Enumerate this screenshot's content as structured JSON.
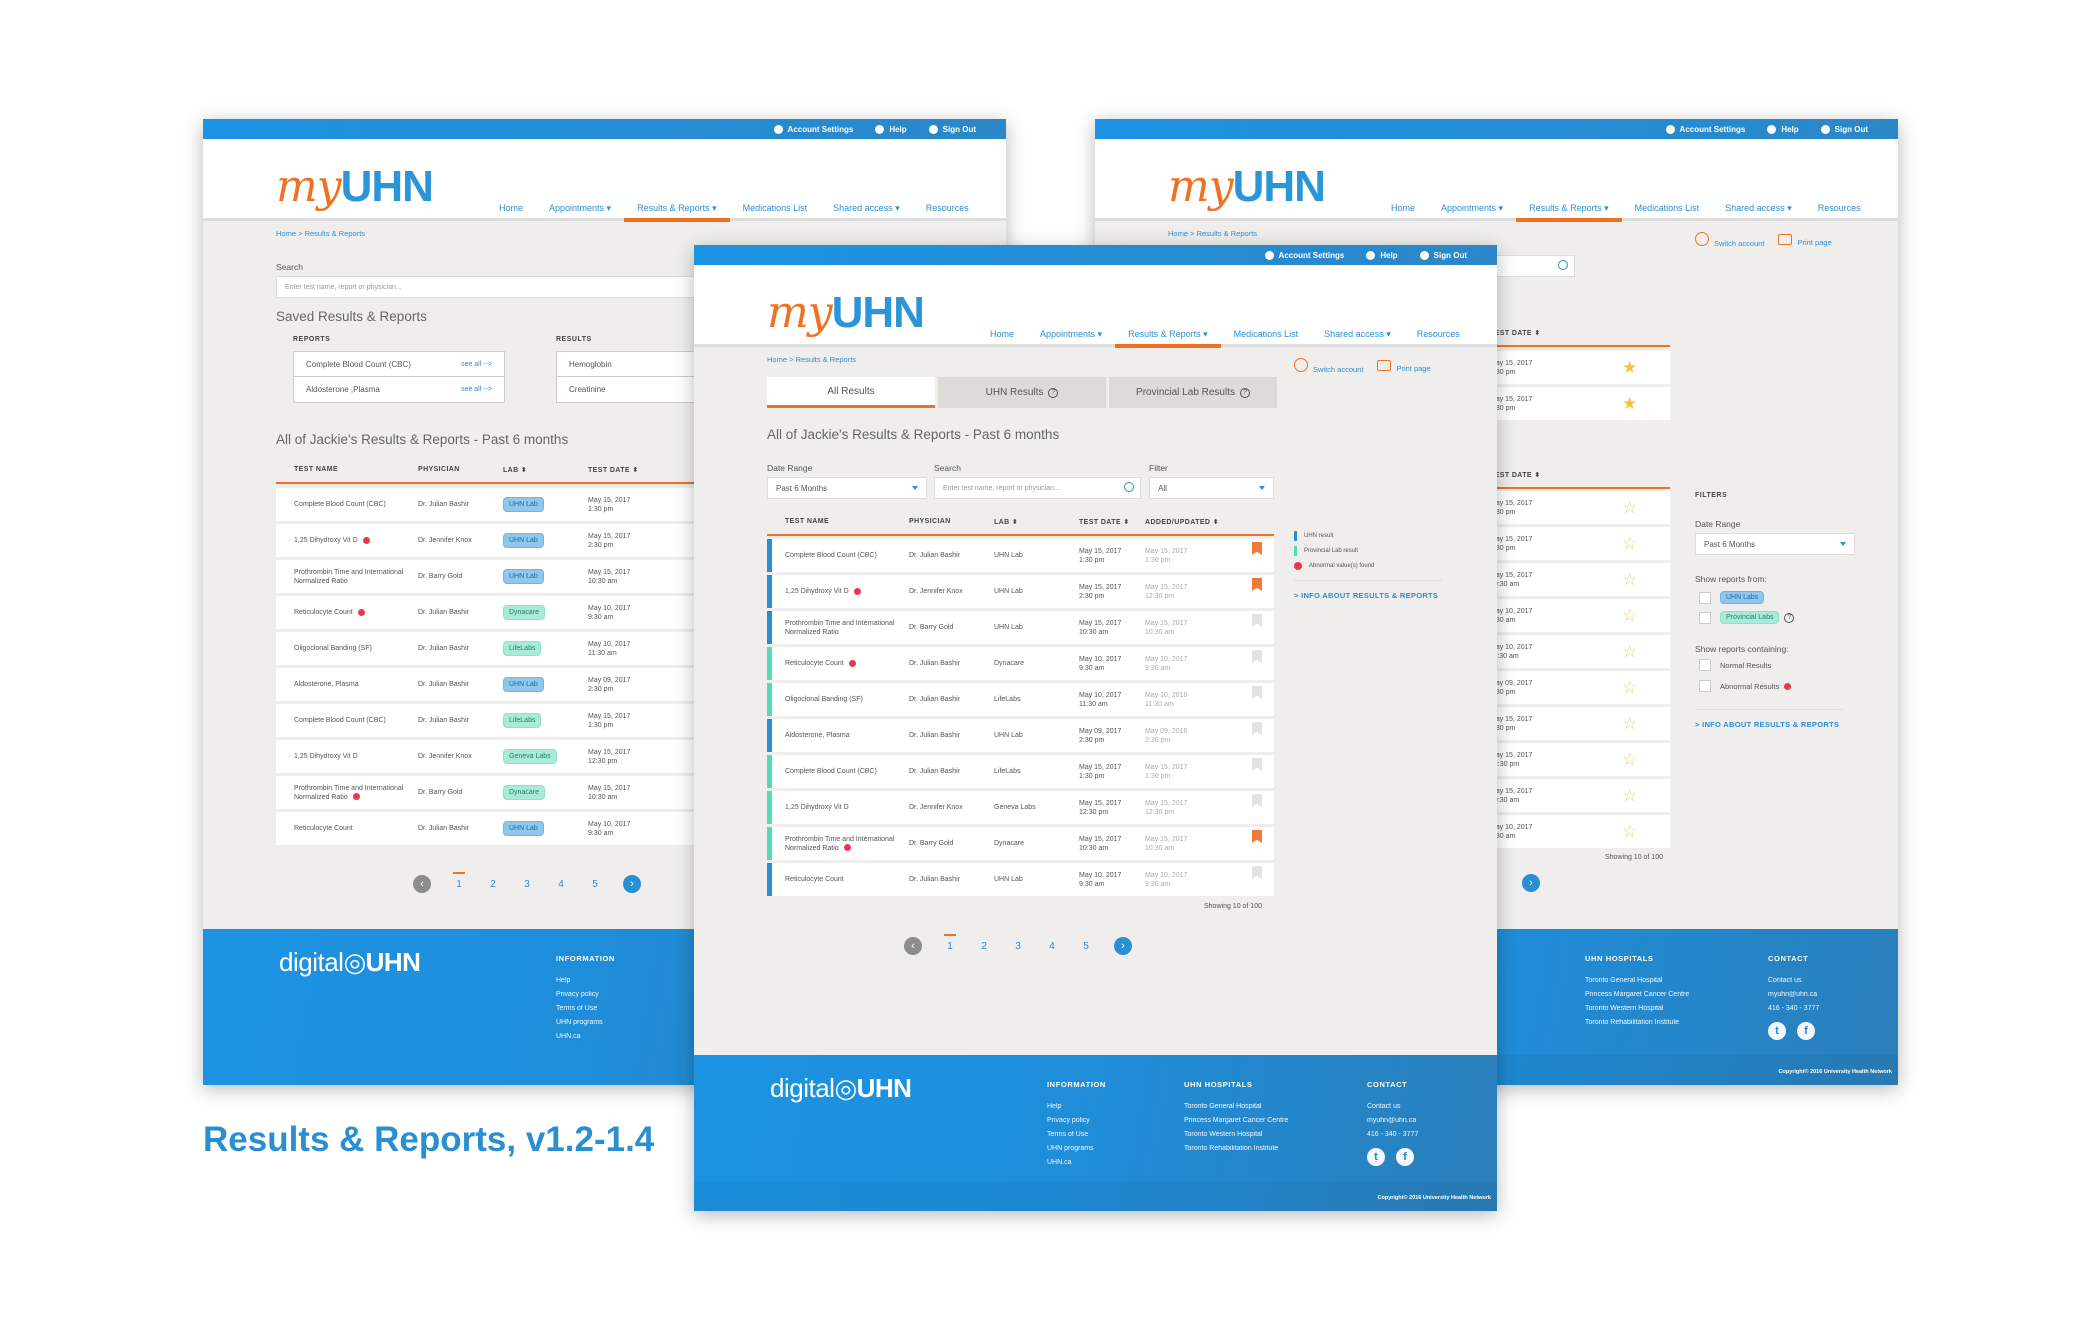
{
  "caption": "Results & Reports, v1.2-1.4",
  "common": {
    "topbar": {
      "account_settings": "Account Settings",
      "help": "Help",
      "sign_out": "Sign Out"
    },
    "logo": {
      "my": "my",
      "uhn": "UHN"
    },
    "nav": [
      "Home",
      "Appointments ▾",
      "Results & Reports ▾",
      "Medications List",
      "Shared access ▾",
      "Resources"
    ],
    "nav_active_index": 2,
    "breadcrumb": {
      "home": "Home",
      "sep": ">",
      "current": "Results & Reports"
    },
    "switch_account": "Switch account",
    "print_page": "Print page",
    "search_placeholder": "Enter test name, report or physician...",
    "showing": "Showing 10 of 100",
    "info_link": "INFO ABOUT RESULTS & REPORTS",
    "pager": {
      "prev": "‹",
      "next": "›",
      "pages": [
        "1",
        "2",
        "3",
        "4",
        "5"
      ],
      "current": "1"
    },
    "footer": {
      "logo_digital": "digital",
      "logo_uhn": "UHN",
      "information": {
        "title": "INFORMATION",
        "links": [
          "Help",
          "Privacy policy",
          "Terms of Use",
          "UHN programs",
          "UHN.ca"
        ]
      },
      "hospitals": {
        "title": "UHN HOSPITALS",
        "links": [
          "Toronto General Hospital",
          "Princess Margaret Cancer Centre",
          "Toronto Western Hospital",
          "Toronto Rehabilitation Institute"
        ]
      },
      "contact": {
        "title": "CONTACT",
        "links": [
          "Contact us",
          "myuhn@uhn.ca",
          "416 - 340 - 3777"
        ],
        "twitter": "t",
        "facebook": "f"
      },
      "copyright": "Copyright© 2016 University Health Network"
    }
  },
  "left": {
    "search_label": "Search",
    "saved_title": "Saved Results & Reports",
    "reports_label": "REPORTS",
    "results_label": "RESULTS",
    "saved_reports": [
      {
        "name": "Complete Blood Count (CBC)",
        "link": "see all -->"
      },
      {
        "name": "Aldosterone ,Plasma",
        "link": "see all -->"
      }
    ],
    "saved_results": [
      "Hemoglobin",
      "Creatinine"
    ],
    "list_title": "All of Jackie's Results & Reports - Past 6 months",
    "columns": [
      "TEST NAME",
      "PHYSICIAN",
      "LAB ⬍",
      "TEST DATE ⬍"
    ]
  },
  "center": {
    "tabs": [
      {
        "label": "All Results",
        "help": false
      },
      {
        "label": "UHN Results",
        "help": true
      },
      {
        "label": "Provincial Lab Results",
        "help": true
      }
    ],
    "list_title": "All of Jackie's Results & Reports - Past 6 months",
    "date_range_label": "Date Range",
    "date_range_value": "Past 6 Months",
    "search_label": "Search",
    "filter_label": "Filter",
    "filter_value": "All",
    "columns": [
      "TEST NAME",
      "PHYSICIAN",
      "LAB ⬍",
      "TEST DATE ⬍",
      "ADDED/UPDATED ⬍"
    ],
    "legend": {
      "uhn": "UHN result",
      "provincial": "Provincial Lab result",
      "abnormal": "Abnormal value(s) found"
    }
  },
  "right": {
    "column": "TEST DATE ⬍",
    "saved_rows": [
      {
        "date": "May 15, 2017",
        "time": "1:30 pm"
      },
      {
        "date": "May 15, 2017",
        "time": "2:30 pm"
      }
    ],
    "filters": {
      "title": "FILTERS",
      "date_range_label": "Date Range",
      "date_range_value": "Past 6 Months",
      "from_label": "Show reports from:",
      "uhn_labs": "UHN Labs",
      "provincial_labs": "Provincial Labs",
      "containing_label": "Show reports containing:",
      "normal": "Normal Results",
      "abnormal": "Abnormal Results"
    }
  },
  "rows": [
    {
      "test": "Complete Blood Count (CBC)",
      "abnormal": false,
      "physician": "Dr. Julian Bashir",
      "lab": "UHN Lab",
      "source": "uhn",
      "date": "May 15, 2017",
      "time": "1:30 pm",
      "added_date": "May 15, 2017",
      "added_time": "1:30 pm",
      "bookmarked": true
    },
    {
      "test": "1,25 Dihydroxy Vit D",
      "abnormal": true,
      "physician": "Dr. Jennifer Knox",
      "lab": "UHN Lab",
      "source": "uhn",
      "date": "May 15, 2017",
      "time": "2:30 pm",
      "added_date": "May 15, 2017",
      "added_time": "12:30 pm",
      "bookmarked": true
    },
    {
      "test": "Prothrombin Time and International Normalized Ratio",
      "abnormal": false,
      "physician": "Dr. Barry Gold",
      "lab": "UHN Lab",
      "source": "uhn",
      "date": "May 15, 2017",
      "time": "10:30 am",
      "added_date": "May 15, 2017",
      "added_time": "10:30 am",
      "bookmarked": false
    },
    {
      "test": "Reticulocyte Count",
      "abnormal": true,
      "physician": "Dr. Julian Bashir",
      "lab": "Dynacare",
      "source": "prov",
      "date": "May 10, 2017",
      "time": "9:30 am",
      "added_date": "May 10, 2017",
      "added_time": "9:30 am",
      "bookmarked": false
    },
    {
      "test": "Oligoclonal Banding (SF)",
      "abnormal": false,
      "physician": "Dr. Julian Bashir",
      "lab": "LifeLabs",
      "source": "prov",
      "date": "May 10, 2017",
      "time": "11:30 am",
      "added_date": "May 10, 2016",
      "added_time": "11:30 am",
      "bookmarked": false
    },
    {
      "test": "Aldosterone, Plasma",
      "abnormal": false,
      "physician": "Dr. Julian Bashir",
      "lab": "UHN Lab",
      "source": "uhn",
      "date": "May 09, 2017",
      "time": "2:30 pm",
      "added_date": "May 09, 2016",
      "added_time": "2:30 pm",
      "bookmarked": false
    },
    {
      "test": "Complete Blood Count (CBC)",
      "abnormal": false,
      "physician": "Dr. Julian Bashir",
      "lab": "LifeLabs",
      "source": "prov",
      "date": "May 15, 2017",
      "time": "1:30 pm",
      "added_date": "May 15, 2017",
      "added_time": "1:30 pm",
      "bookmarked": false
    },
    {
      "test": "1,25 Dihydroxy Vit D",
      "abnormal": false,
      "physician": "Dr. Jennifer Knox",
      "lab": "Geneva Labs",
      "source": "prov",
      "date": "May 15, 2017",
      "time": "12:30 pm",
      "added_date": "May 15, 2017",
      "added_time": "12:30 pm",
      "bookmarked": false
    },
    {
      "test": "Prothrombin Time and International Normalized Ratio",
      "abnormal": true,
      "physician": "Dr. Barry Gold",
      "lab": "Dynacare",
      "source": "prov",
      "date": "May 15, 2017",
      "time": "10:30 am",
      "added_date": "May 15, 2017",
      "added_time": "10:30 am",
      "bookmarked": true
    },
    {
      "test": "Reticulocyte Count",
      "abnormal": false,
      "physician": "Dr. Julian Bashir",
      "lab": "UHN Lab",
      "source": "uhn",
      "date": "May 10, 2017",
      "time": "9:30 am",
      "added_date": "May 10, 2017",
      "added_time": "9:30 am",
      "bookmarked": false
    }
  ],
  "colors": {
    "brand_blue": "#2a8fd0",
    "accent_orange": "#ef7223",
    "uhn_bar": "#2a8fd0",
    "provincial_bar": "#4fdcb6",
    "abnormal": "#e8384f",
    "star": "#f5c33b"
  }
}
